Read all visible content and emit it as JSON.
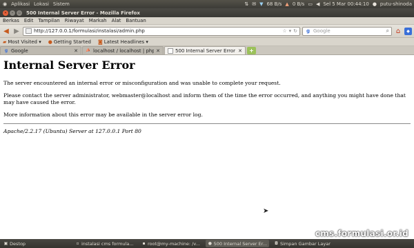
{
  "system_panel": {
    "apps_menu": "Aplikasi",
    "places_menu": "Lokasi",
    "system_menu": "Sistem",
    "download_speed": "68 B/s",
    "upload_speed": "0 B/s",
    "clock": "Sel 5 Mar 00:44:10",
    "user": "putu-shinoda"
  },
  "window": {
    "title": "500 Internal Server Error - Mozilla Firefox"
  },
  "menubar": {
    "items": [
      "Berkas",
      "Edit",
      "Tampilan",
      "Riwayat",
      "Markah",
      "Alat",
      "Bantuan"
    ]
  },
  "navbar": {
    "url": "http://127.0.0.1/formulasi/instalasi/admin.php",
    "search_placeholder": "Google"
  },
  "bookmarks": {
    "items": [
      "Most Visited ▾",
      "Getting Started",
      "Latest Headlines ▾"
    ]
  },
  "tabs": [
    {
      "label": "Google"
    },
    {
      "label": "localhost / localhost | phpM..."
    },
    {
      "label": "500 Internal Server Error"
    }
  ],
  "page": {
    "heading": "Internal Server Error",
    "para1": "The server encountered an internal error or misconfiguration and was unable to complete your request.",
    "para2": "Please contact the server administrator, webmaster@localhost and inform them of the time the error occurred, and anything you might have done that may have caused the error.",
    "para3": "More information about this error may be available in the server error log.",
    "signature": "Apache/2.2.17 (Ubuntu) Server at 127.0.0.1 Port 80"
  },
  "watermark": "cms.formulasi.or.id",
  "taskbar": {
    "items": [
      {
        "label": "Destop"
      },
      {
        "label": "instalasi cms formula..."
      },
      {
        "label": "root@my-machine: /v..."
      },
      {
        "label": "500 Internal Server Er..."
      },
      {
        "label": "Simpan Gambar Layar"
      }
    ]
  },
  "colors": {
    "accent_orange": "#e8623a",
    "panel_dark": "#3c3b37"
  }
}
